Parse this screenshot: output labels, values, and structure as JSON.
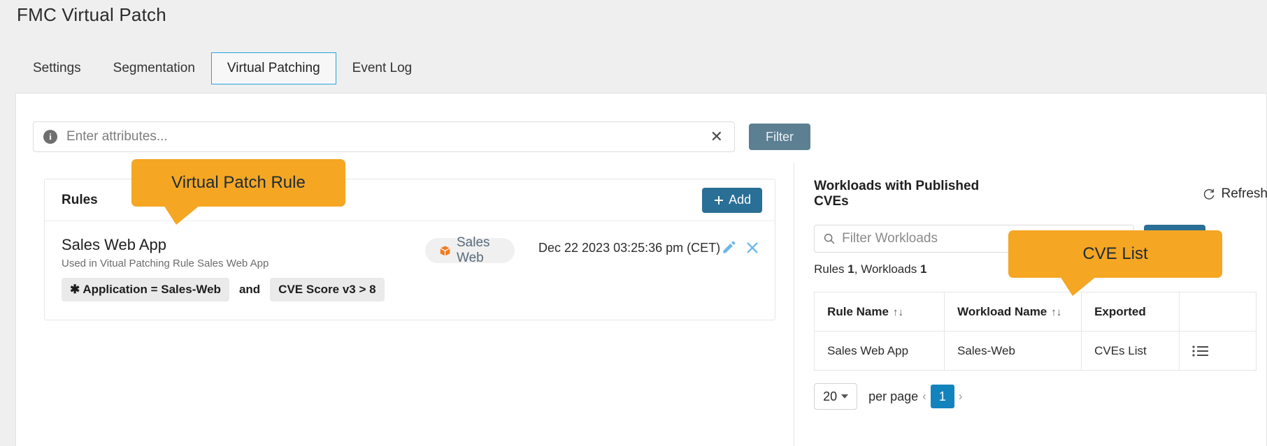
{
  "page": {
    "title": "FMC Virtual Patch"
  },
  "tabs": [
    {
      "label": "Settings",
      "active": false
    },
    {
      "label": "Segmentation",
      "active": false
    },
    {
      "label": "Virtual Patching",
      "active": true
    },
    {
      "label": "Event Log",
      "active": false
    }
  ],
  "filter_bar": {
    "info_icon": "info-icon",
    "attributes_placeholder": "Enter attributes...",
    "attributes_value": "",
    "clear_icon": "close-icon",
    "filter_button": "Filter"
  },
  "rules_panel": {
    "heading": "Rules",
    "add_button": "+ Add",
    "add_icon": "plus-icon",
    "rows": [
      {
        "name": "Sales Web App",
        "subtitle": "Used in Vitual Patching Rule Sales Web App",
        "workload_chip": "Sales Web",
        "workload_chip_icon": "cube-icon",
        "timestamp": "Dec 22 2023 03:25:36 pm (CET)",
        "edit_icon": "pencil-icon",
        "delete_icon": "close-icon",
        "conditions": [
          {
            "text": "✱ Application = Sales-Web"
          },
          {
            "text": "CVE Score v3 > 8"
          }
        ],
        "conjunction": "and"
      }
    ]
  },
  "workloads_panel": {
    "heading": "Workloads with Published CVEs",
    "refresh_label": "Refresh",
    "refresh_icon": "refresh-icon",
    "search_placeholder": "Filter Workloads",
    "search_value": "",
    "search_icon": "search-icon",
    "apply_button": "",
    "counts": {
      "rules_label": "Rules",
      "rules_value": "1",
      "workloads_label": "Workloads",
      "workloads_value": "1",
      "separator": ", "
    },
    "table": {
      "columns": [
        "Rule Name",
        "Workload Name",
        "Exported",
        ""
      ],
      "sort_icon": "↑↓",
      "rows": [
        {
          "rule_name": "Sales Web App",
          "workload_name": "Sales-Web",
          "exported": "CVEs List",
          "menu_icon": "list-icon"
        }
      ]
    },
    "pagination": {
      "per_page_value": "20",
      "per_page_label": "per page",
      "prev_icon": "‹",
      "current_page": "1",
      "next_icon": "›"
    }
  },
  "callouts": [
    {
      "id": "virtual-patch-rule",
      "text": "Virtual Patch Rule"
    },
    {
      "id": "cve-list",
      "text": "CVE List"
    }
  ],
  "colors": {
    "accent_blue": "#26a3dd",
    "button_blue": "#2a6f96",
    "filter_slate": "#5c7f92",
    "callout_orange": "#f5a623",
    "link_blue": "#1f7ab5",
    "page_blue": "#1383bd",
    "cube_orange": "#f07c22"
  }
}
